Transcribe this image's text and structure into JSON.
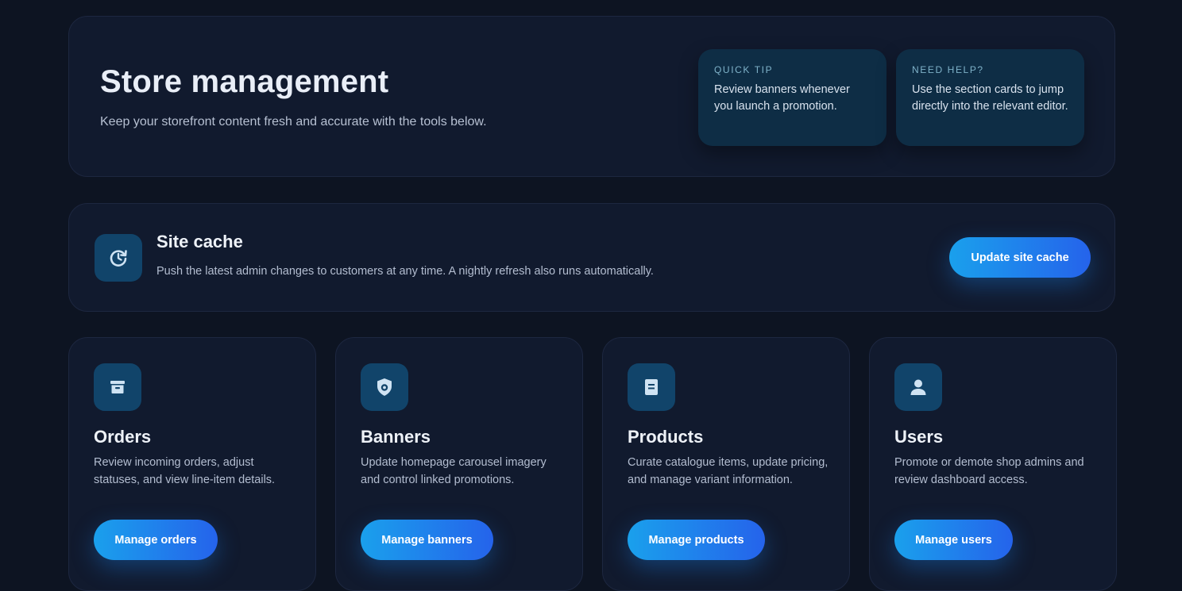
{
  "hero": {
    "title": "Store management",
    "subtitle": "Keep your storefront content fresh and accurate with the tools below.",
    "tips": [
      {
        "label": "QUICK TIP",
        "text": "Review banners whenever you launch a promotion."
      },
      {
        "label": "NEED HELP?",
        "text": "Use the section cards to jump directly into the relevant editor."
      }
    ]
  },
  "cache": {
    "icon": "refresh-clock-icon",
    "title": "Site cache",
    "description": "Push the latest admin changes to customers at any time. A nightly refresh also runs automatically.",
    "button_label": "Update site cache"
  },
  "cards": [
    {
      "icon": "archive-box-icon",
      "title": "Orders",
      "description": "Review incoming orders, adjust statuses, and view line-item details.",
      "button_label": "Manage orders"
    },
    {
      "icon": "shield-eye-icon",
      "title": "Banners",
      "description": "Update homepage carousel imagery and control linked promotions.",
      "button_label": "Manage banners"
    },
    {
      "icon": "document-icon",
      "title": "Products",
      "description": "Curate catalogue items, update pricing, and manage variant information.",
      "button_label": "Manage products"
    },
    {
      "icon": "user-icon",
      "title": "Users",
      "description": "Promote or demote shop admins and review dashboard access.",
      "button_label": "Manage users"
    }
  ],
  "colors": {
    "background": "#0d1422",
    "panel": "#111a2e",
    "tip_panel": "#0e2d45",
    "icon_tile": "#11446a",
    "button_gradient_start": "#1aa0ec",
    "button_gradient_end": "#2563eb"
  }
}
